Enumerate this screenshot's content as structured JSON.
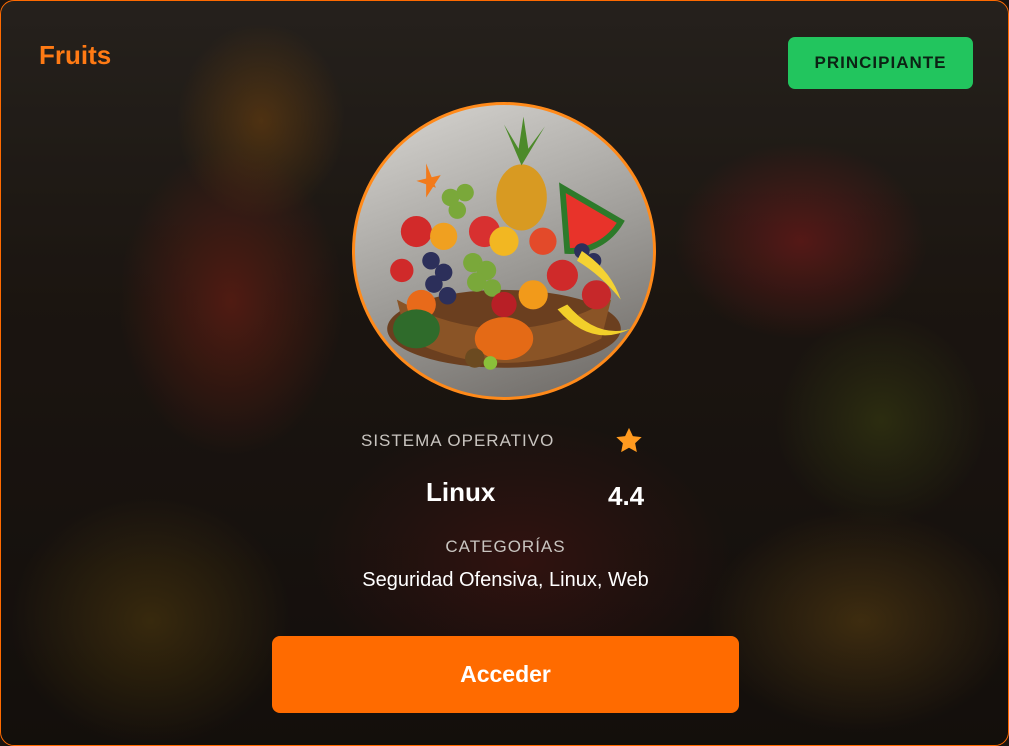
{
  "card": {
    "title": "Fruits",
    "difficulty_badge": "PRINCIPIANTE",
    "os_label": "SISTEMA OPERATIVO",
    "os_value": "Linux",
    "rating_icon": "star-icon",
    "rating_value": "4.4",
    "categories_label": "CATEGORÍAS",
    "categories_value": "Seguridad Ofensiva, Linux, Web",
    "access_button_label": "Acceder"
  },
  "colors": {
    "accent": "#ff6b00",
    "badge_green": "#22c55e",
    "star": "#ff9a1f"
  }
}
